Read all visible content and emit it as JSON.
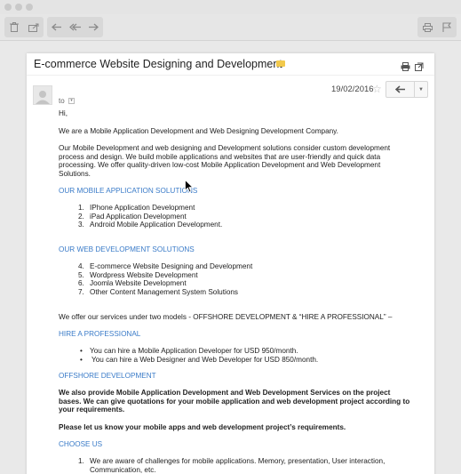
{
  "toolbar": {
    "buttons": [
      "trash-icon",
      "move-icon",
      "reply-icon",
      "reply-all-icon",
      "forward-icon",
      "print-icon",
      "flag-icon"
    ]
  },
  "email": {
    "subject": "E-commerce Website Designing and Development",
    "to_label": "to",
    "date": "19/02/2016",
    "greeting": "Hi,",
    "intro": "We are a Mobile Application Development and Web Designing Development Company.",
    "para1_lines": [
      "Our Mobile Development and web designing and Development solutions consider custom development",
      "process and design. We build mobile applications and websites that are user-friendly and quick data",
      "processing. We offer quality-driven low-cost Mobile Application Development and Web Development",
      "Solutions."
    ],
    "mobile_heading": "OUR MOBILE APPLICATION SOLUTIONS",
    "mobile_items": [
      {
        "num": "1.",
        "text": "IPhone Application Development"
      },
      {
        "num": "2.",
        "text": "iPad Application Development"
      },
      {
        "num": "3.",
        "text": "Android Mobile Application Development."
      }
    ],
    "web_heading": "OUR WEB DEVELOPMENT SOLUTIONS",
    "web_items": [
      {
        "num": "4.",
        "text": "E-commerce Website Designing and Development"
      },
      {
        "num": "5.",
        "text": "Wordpress Website Development"
      },
      {
        "num": "6.",
        "text": "Joomla Website Development"
      },
      {
        "num": "7.",
        "text": "Other Content Management System Solutions"
      }
    ],
    "models_text": "We offer our services under two models - OFFSHORE DEVELOPMENT & “HIRE A PROFESSIONAL” –",
    "hire_heading": "HIRE A PROFESSIONAL",
    "hire_items": [
      "You can hire a Mobile Application Developer for USD 950/month.",
      "You can hire a Web Designer and Web Developer for USD 850/month."
    ],
    "offshore_heading": "OFFSHORE DEVELOPMENT",
    "bold_lines": [
      "We also provide Mobile Application Development and Web Development Services on the project",
      "bases. We can give quotations for your mobile application and web development project according to",
      "your requirements."
    ],
    "cta": "Please let us know your mobile apps and web development project’s requirements.",
    "choose_heading": "CHOOSE US",
    "choose_items": [
      {
        "num": "1.",
        "lines": [
          "We are aware of challenges for mobile applications. Memory, presentation, User interaction,",
          "Communication, etc."
        ]
      }
    ]
  },
  "colors": {
    "link_blue": "#3a7bc8",
    "label_yellow": "#f2c94c"
  }
}
